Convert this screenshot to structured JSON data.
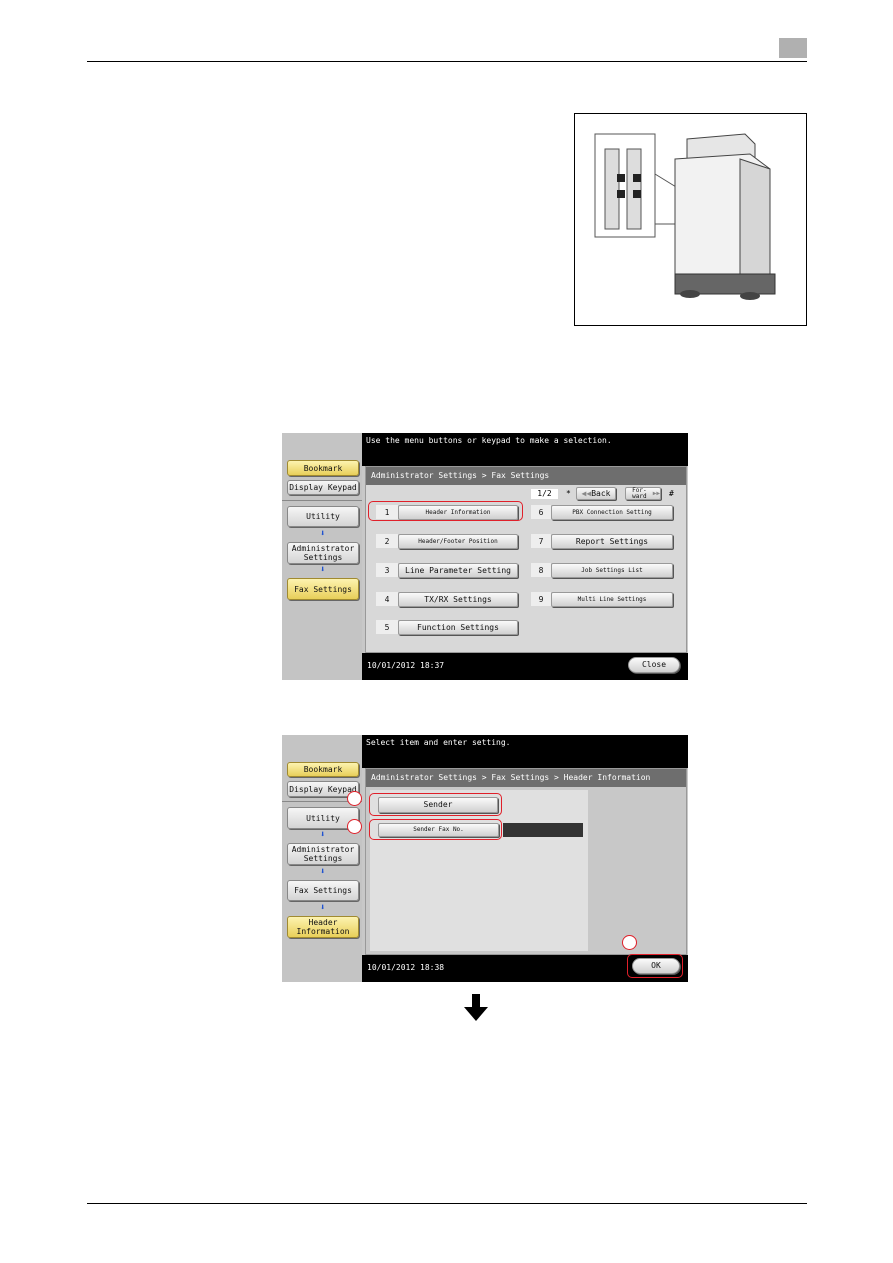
{
  "page_header": {
    "box_color": "#b0b0b0"
  },
  "screen1": {
    "message": "Use the menu buttons or keypad to make a selection.",
    "sidebar": {
      "bookmark": "Bookmark",
      "display_keypad": "Display Keypad",
      "utility": "Utility",
      "admin_settings": "Administrator Settings",
      "fax_settings": "Fax Settings"
    },
    "breadcrumb": "Administrator Settings  > Fax Settings",
    "pager": {
      "page": "1/2",
      "star": "*",
      "back": "Back",
      "forward": "For-ward",
      "hash": "#"
    },
    "items": [
      {
        "num": "1",
        "label": "Header Information"
      },
      {
        "num": "2",
        "label": "Header/Footer Position"
      },
      {
        "num": "3",
        "label": "Line Parameter Setting"
      },
      {
        "num": "4",
        "label": "TX/RX Settings"
      },
      {
        "num": "5",
        "label": "Function Settings"
      },
      {
        "num": "6",
        "label": "PBX Connection Setting"
      },
      {
        "num": "7",
        "label": "Report Settings"
      },
      {
        "num": "8",
        "label": "Job Settings List"
      },
      {
        "num": "9",
        "label": "Multi Line Settings"
      }
    ],
    "date": "10/01/2012",
    "time": "18:37",
    "close": "Close"
  },
  "screen2": {
    "message": "Select item and enter setting.",
    "sidebar": {
      "bookmark": "Bookmark",
      "display_keypad": "Display Keypad",
      "utility": "Utility",
      "admin_settings": "Administrator Settings",
      "fax_settings": "Fax Settings",
      "header_information": "Header Information"
    },
    "breadcrumb": "Administrator Settings  > Fax Settings  > Header Information",
    "sender": "Sender",
    "sender_fax_no": "Sender Fax No.",
    "date": "10/01/2012",
    "time": "18:38",
    "ok": "OK"
  },
  "colors": {
    "highlight": "#e0202a",
    "arrow_blue": "#1a4fd0",
    "gold_button": "#e8cf5a"
  }
}
